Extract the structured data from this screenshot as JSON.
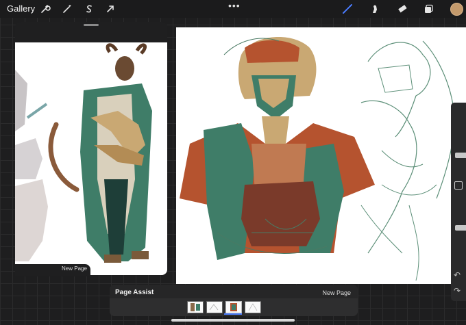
{
  "topbar": {
    "gallery_label": "Gallery",
    "actions": [
      {
        "name": "actions-wrench-icon"
      },
      {
        "name": "adjustments-wand-icon"
      },
      {
        "name": "selection-s-icon"
      },
      {
        "name": "transform-arrow-icon"
      }
    ],
    "more_label": "•••",
    "tools": [
      {
        "name": "brush-icon",
        "active": true
      },
      {
        "name": "smudge-icon"
      },
      {
        "name": "eraser-icon"
      },
      {
        "name": "layers-icon"
      }
    ],
    "color_hex": "#c49a6c"
  },
  "reference_panel": {
    "new_page_label": "New Page"
  },
  "page_assist": {
    "title": "Page Assist",
    "new_page_label": "New Page",
    "pages": [
      {
        "name": "page-thumb-1",
        "active": false
      },
      {
        "name": "page-thumb-2",
        "active": false
      },
      {
        "name": "page-thumb-3",
        "active": true
      },
      {
        "name": "page-thumb-4",
        "active": false
      }
    ]
  },
  "sidebar": {
    "brush_size_level": 0.25,
    "opacity_level": 0.55,
    "undo_icon": "undo-icon",
    "redo_icon": "redo-icon"
  },
  "colors": {
    "accent": "#4a7cff",
    "teal": "#3f7d68",
    "rust": "#b5532f",
    "gold": "#c9a873"
  }
}
